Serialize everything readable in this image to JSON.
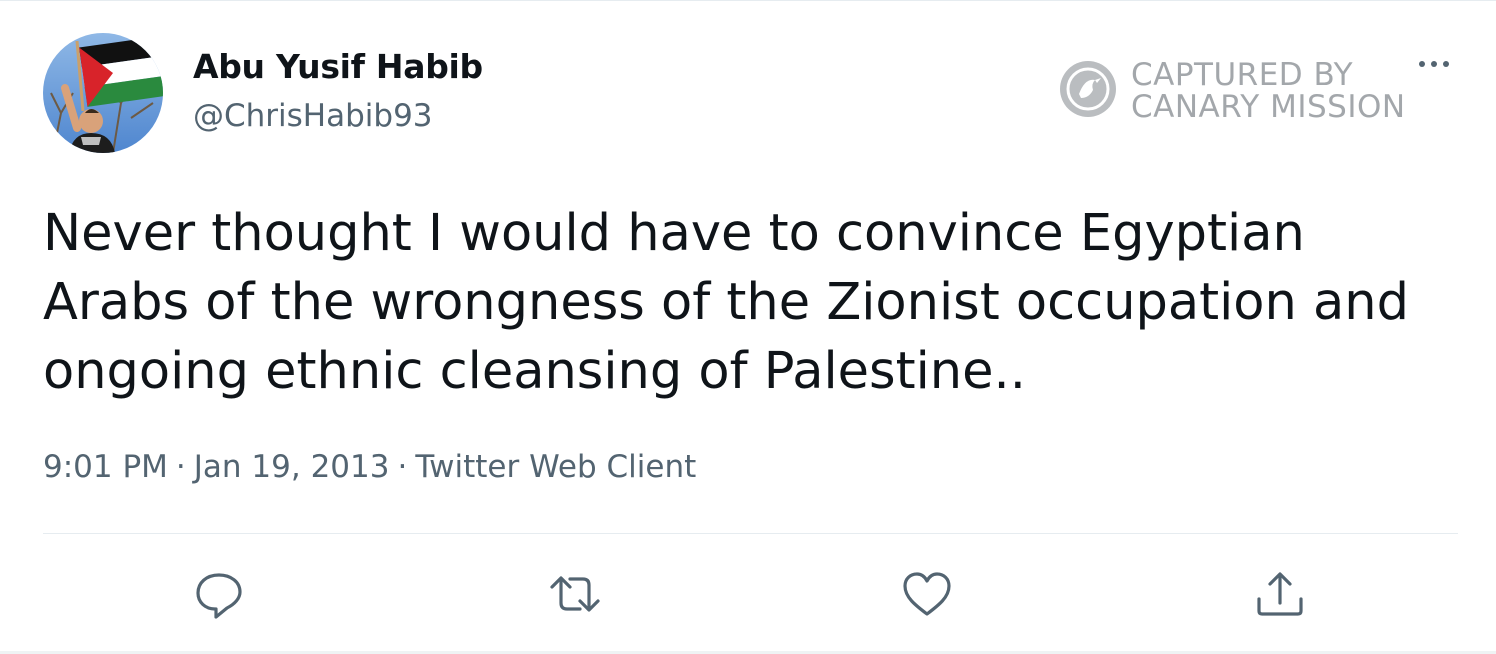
{
  "user": {
    "display_name": "Abu Yusif Habib",
    "handle": "@ChrisHabib93",
    "avatar_icon": "profile-photo-with-palestinian-flag"
  },
  "watermark": {
    "line1": "CAPTURED BY",
    "line2": "CANARY MISSION",
    "icon": "canary-bird-icon"
  },
  "tweet": {
    "text": "Never thought I would have to convince Egyptian Arabs of the wrongness of the Zionist occupation and ongoing ethnic cleansing of Palestine..",
    "time": "9:01 PM",
    "separator": "·",
    "date": "Jan 19, 2013",
    "client": "Twitter Web Client"
  },
  "actions": {
    "reply_icon": "reply-icon",
    "retweet_icon": "retweet-icon",
    "like_icon": "heart-icon",
    "share_icon": "share-icon",
    "more_icon": "more-options-icon"
  },
  "colors": {
    "text_primary": "#0f1419",
    "text_secondary": "#536471",
    "divider": "#e6ecf0",
    "icon": "#536471",
    "watermark": "#8a8f94"
  }
}
